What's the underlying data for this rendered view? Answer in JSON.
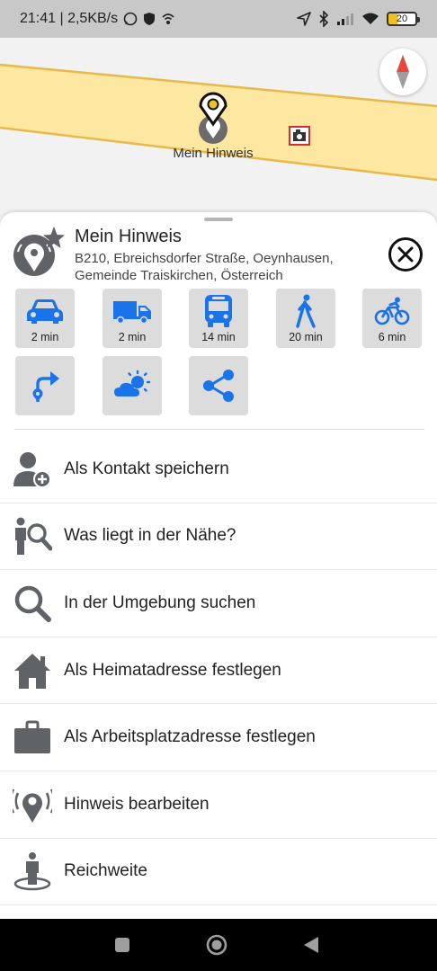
{
  "status_bar": {
    "time_net": "21:41 | 2,5KB/s",
    "battery": "20"
  },
  "map": {
    "label": "Mein Hinweis",
    "road_color": "#fde7a1",
    "road_edge_color": "#e9b84a"
  },
  "poi": {
    "title": "Mein Hinweis",
    "address": "B210, Ebreichsdorfer Straße, Oeynhausen, Gemeinde Traiskirchen, Österreich"
  },
  "travel": [
    {
      "mode": "car-icon",
      "time": "2 min"
    },
    {
      "mode": "truck-icon",
      "time": "2 min"
    },
    {
      "mode": "bus-icon",
      "time": "14 min"
    },
    {
      "mode": "walk-icon",
      "time": "20 min"
    },
    {
      "mode": "bike-icon",
      "time": "6 min"
    }
  ],
  "actions": [
    {
      "icon": "navigate-to-icon"
    },
    {
      "icon": "weather-icon"
    },
    {
      "icon": "share-icon"
    }
  ],
  "menu": [
    {
      "icon": "add-contact-icon",
      "label": "Als Kontakt speichern"
    },
    {
      "icon": "nearby-icon",
      "label": "Was liegt in der Nähe?"
    },
    {
      "icon": "search-icon",
      "label": "In der Umgebung suchen"
    },
    {
      "icon": "home-icon",
      "label": "Als Heimatadresse festlegen"
    },
    {
      "icon": "briefcase-icon",
      "label": "Als Arbeitsplatzadresse festlegen"
    },
    {
      "icon": "edit-poi-icon",
      "label": "Hinweis bearbeiten"
    },
    {
      "icon": "range-icon",
      "label": "Reichweite"
    }
  ],
  "colors": {
    "accent_blue": "#1a73e8",
    "icon_gray": "#5f6368",
    "tile_bg": "#dcdcdc"
  }
}
